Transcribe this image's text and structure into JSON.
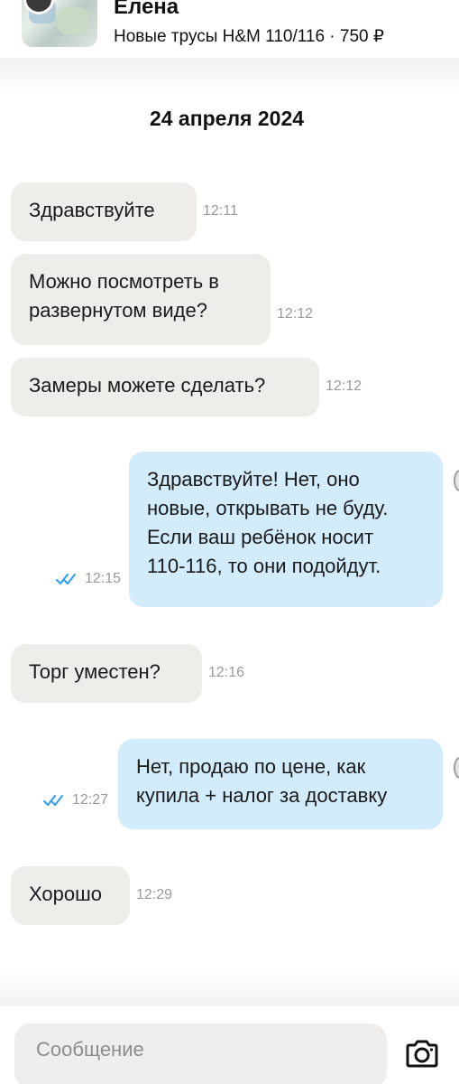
{
  "header": {
    "seller_name": "Елена",
    "listing": "Новые трусы H&M 110/116 · 750 ₽"
  },
  "chat": {
    "date": "24 апреля 2024",
    "messages": [
      {
        "direction": "in",
        "lines": [
          "Здравствуйте"
        ],
        "time": "12:11"
      },
      {
        "direction": "in",
        "lines": [
          "Можно посмотреть в",
          "развернутом виде?"
        ],
        "time": "12:12"
      },
      {
        "direction": "in",
        "lines": [
          "Замеры можете сделать?"
        ],
        "time": "12:12"
      },
      {
        "direction": "out",
        "lines": [
          "Здравствуйте! Нет, оно",
          "новые, открывать не буду.",
          "Если ваш ребёнок носит",
          "110-116, то они подойдут."
        ],
        "time": "12:15",
        "read": true
      },
      {
        "direction": "in",
        "lines": [
          "Торг уместен?"
        ],
        "time": "12:16"
      },
      {
        "direction": "out",
        "lines": [
          "Нет, продаю по цене, как",
          "купила + налог за доставку"
        ],
        "time": "12:27",
        "read": true
      },
      {
        "direction": "in",
        "lines": [
          "Хорошо"
        ],
        "time": "12:29"
      }
    ]
  },
  "composer": {
    "placeholder": "Сообщение",
    "camera_icon": "camera-icon"
  },
  "colors": {
    "incoming_bubble": "#efedea",
    "outgoing_bubble": "#d2ecfb",
    "read_check": "#2a9df4",
    "timestamp": "#9a9a9a"
  }
}
